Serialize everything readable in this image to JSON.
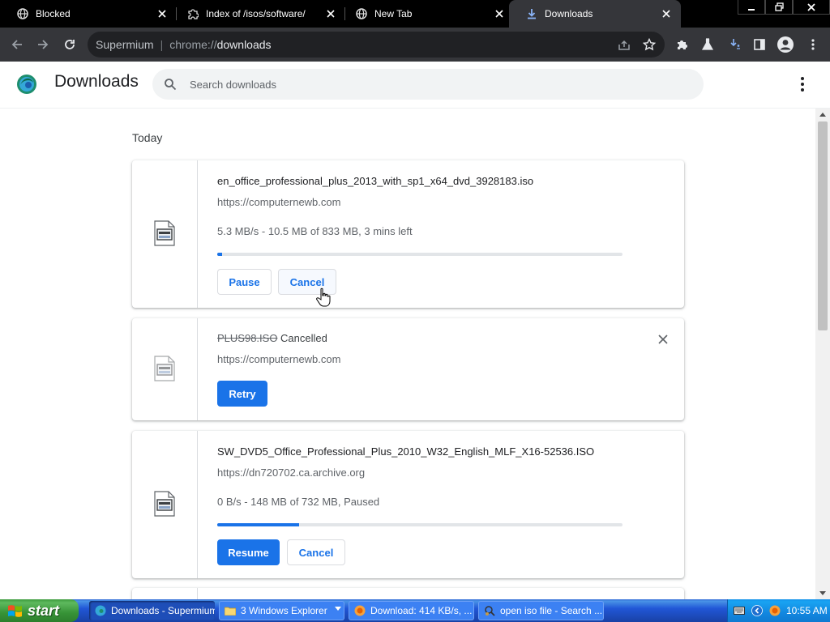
{
  "browser": {
    "tabs": [
      {
        "title": "Blocked",
        "icon": "globe-icon",
        "active": false
      },
      {
        "title": "Index of /isos/software/",
        "icon": "puzzle-icon",
        "active": false
      },
      {
        "title": "New Tab",
        "icon": "globe-icon",
        "active": false
      },
      {
        "title": "Downloads",
        "icon": "download-icon",
        "active": true
      }
    ],
    "omnibox": {
      "brand": "Supermium",
      "separator": "|",
      "scheme": "chrome://",
      "path": "downloads"
    }
  },
  "page": {
    "title": "Downloads",
    "search": {
      "placeholder": "Search downloads",
      "value": ""
    },
    "date_heading": "Today"
  },
  "downloads": [
    {
      "filename": "en_office_professional_plus_2013_with_sp1_x64_dvd_3928183.iso",
      "source": "https://computernewb.com",
      "progress_text": "5.3 MB/s - 10.5 MB of 833 MB, 3 mins left",
      "progress_fraction": 0.0126,
      "buttons": {
        "primary": "Pause",
        "secondary": "Cancel"
      }
    },
    {
      "filename": "PLUS98.ISO",
      "status": "Cancelled",
      "source": "https://computernewb.com",
      "buttons": {
        "primary": "Retry"
      }
    },
    {
      "filename": "SW_DVD5_Office_Professional_Plus_2010_W32_English_MLF_X16-52536.ISO",
      "source": "https://dn720702.ca.archive.org",
      "progress_text": "0 B/s - 148 MB of 732 MB, Paused",
      "progress_fraction": 0.2022,
      "buttons": {
        "primary": "Resume",
        "secondary": "Cancel"
      }
    }
  ],
  "taskbar": {
    "start_label": "start",
    "tasks": [
      {
        "label": "Downloads - Supermium",
        "active": true
      },
      {
        "label": "3 Windows Explorer",
        "active": false
      },
      {
        "label": "Download: 414 KB/s, ...",
        "active": false
      },
      {
        "label": "open iso file - Search ...",
        "active": false
      }
    ],
    "clock": "10:55 AM"
  },
  "colors": {
    "accent": "#1a73e8",
    "tabstrip": "#000000",
    "toolbar": "#35363a",
    "taskbar": "#2157d7",
    "start_button": "#3c9a3c"
  }
}
